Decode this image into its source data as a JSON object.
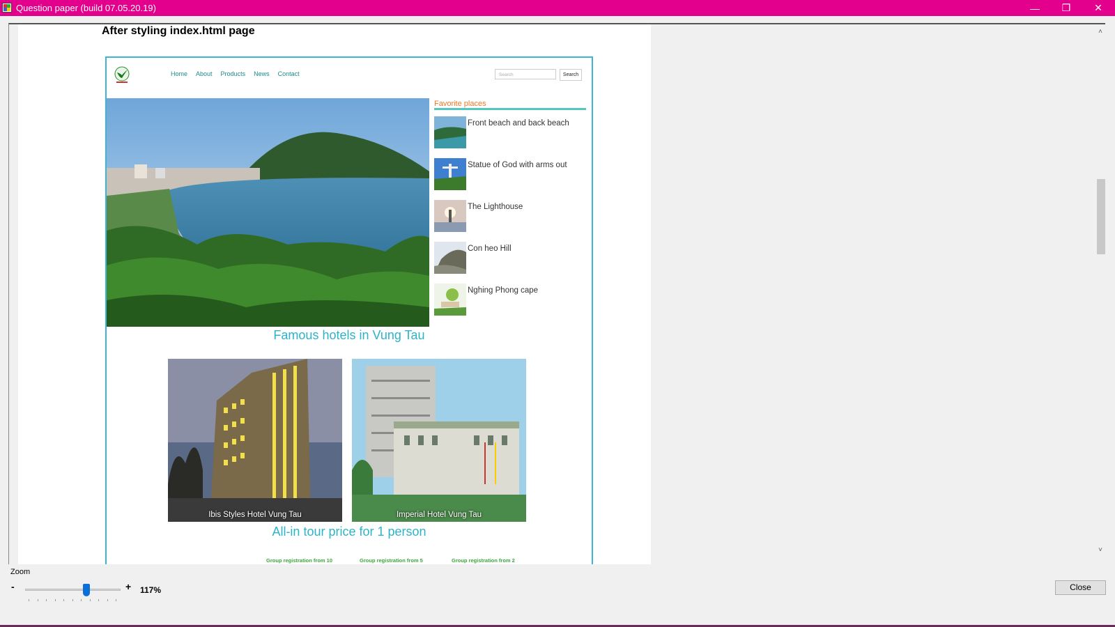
{
  "window": {
    "title": "Question paper (build 07.05.20.19)",
    "minimize_glyph": "—",
    "restore_glyph": "❐",
    "close_glyph": "✕",
    "titlebar_color": "#e3008c"
  },
  "document": {
    "heading": "After styling index.html page",
    "site": {
      "nav": [
        "Home",
        "About",
        "Products",
        "News",
        "Contact"
      ],
      "search_placeholder": "Search",
      "search_button": "Search",
      "favorites_title": "Favorite places",
      "favorites": [
        "Front beach and back beach",
        "Statue of God with arms out",
        "The Lighthouse",
        "Con heo Hill",
        "Nghing Phong cape"
      ],
      "hotels_title": "Famous hotels in Vung Tau",
      "hotels": [
        "Ibis Styles Hotel Vung Tau",
        "Imperial Hotel Vung Tau"
      ],
      "price_title": "All-in tour price for 1 person",
      "price_columns": [
        "Group registration from 10",
        "Group registration from 5",
        "Group registration from 2"
      ],
      "accent_color": "#2db3c9",
      "nav_color": "#1a8c8c",
      "favorites_title_color": "#f07828"
    }
  },
  "zoom": {
    "label": "Zoom",
    "minus": "-",
    "plus": "+",
    "value": "117%",
    "slider_fraction": 0.64
  },
  "footer": {
    "close_label": "Close"
  },
  "icons": {
    "scroll_up": "chevron-up-icon",
    "scroll_down": "chevron-down-icon",
    "app": "app-icon"
  }
}
